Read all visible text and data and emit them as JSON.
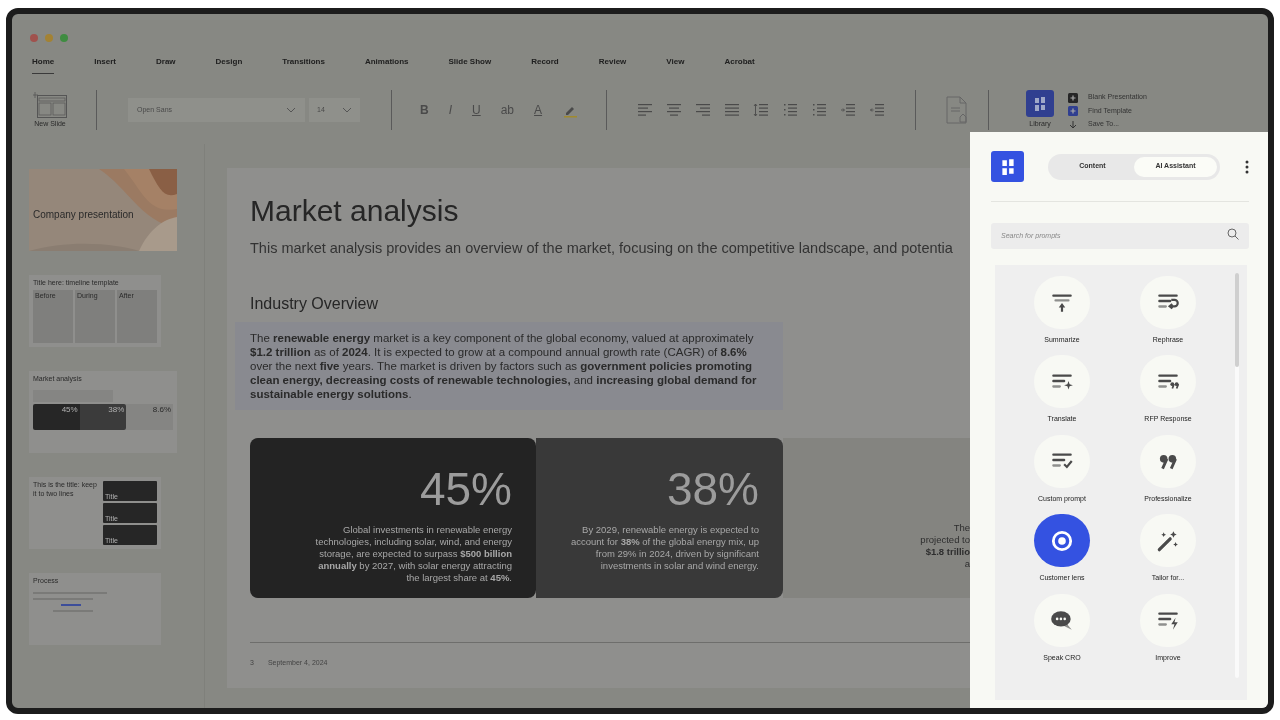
{
  "window": {
    "controls": [
      {
        "color": "#a0524d"
      },
      {
        "color": "#a38233"
      },
      {
        "color": "#3f8c41"
      }
    ]
  },
  "ribbon": {
    "tabs": [
      {
        "label": "Home",
        "selected": true
      },
      {
        "label": "Insert",
        "selected": false
      },
      {
        "label": "Draw",
        "selected": false
      },
      {
        "label": "Design",
        "selected": false
      },
      {
        "label": "Transitions",
        "selected": false
      },
      {
        "label": "Animations",
        "selected": false
      },
      {
        "label": "Slide Show",
        "selected": false
      },
      {
        "label": "Record",
        "selected": false
      },
      {
        "label": "Review",
        "selected": false
      },
      {
        "label": "View",
        "selected": false
      },
      {
        "label": "Acrobat",
        "selected": false
      }
    ],
    "new_slide": "New Slide",
    "font": "Open Sans",
    "size": "14",
    "format_buttons": [
      "B",
      "I",
      "U",
      "ab",
      "A"
    ],
    "library": "Library",
    "actions": [
      {
        "kind": "plus-dark",
        "label": "Blank Presentation"
      },
      {
        "kind": "plus-blue",
        "label": "Find Template"
      },
      {
        "kind": "save",
        "label": "Save To..."
      }
    ]
  },
  "thumbnails": [
    {
      "kind": "cover",
      "title": "Company presentation"
    },
    {
      "kind": "timeline",
      "title": "Title here: timeline template",
      "columns": [
        "Before",
        "During",
        "After"
      ]
    },
    {
      "kind": "stats",
      "title": "Market analysis",
      "stats": [
        "45%",
        "38%",
        "8.6%"
      ]
    },
    {
      "kind": "cards",
      "title": "This is the title: keep it to two lines",
      "cards": [
        "Title",
        "Title",
        "Title"
      ]
    },
    {
      "kind": "process",
      "title": "Process"
    }
  ],
  "slide": {
    "title": "Market analysis",
    "subtitle": "This market analysis provides an overview of the market, focusing on the competitive landscape, and potentia",
    "section": "Industry Overview",
    "paragraph": "The **renewable energy** market is a key component of the global economy, valued at approximately **$1.2 trillion** as of **2024**. It is expected to grow at a compound annual growth rate (CAGR) of **8.6%** over the next **five** years. The market is driven by factors such as **government policies promoting clean energy, decreasing costs of renewable technologies,** and **increasing global demand for sustainable energy solutions**.",
    "stats": [
      {
        "value": "45%",
        "text": "Global investments in renewable energy technologies, including solar, wind, and energy storage, are expected to surpass **$500 billion annually** by 2027, with solar energy attracting the largest share at **45%**."
      },
      {
        "value": "38%",
        "text": "By 2029, renewable energy is expected to account for **38%** of the global energy mix, up from 29% in 2024, driven by significant investments in solar and wind energy."
      }
    ],
    "partial_stat_lines": [
      "The",
      "projected to",
      "**$1.8 trillio**",
      "a"
    ],
    "footer": {
      "page": "3",
      "date": "September 4, 2024"
    }
  },
  "panel": {
    "tabs": [
      {
        "label": "Content",
        "selected": false
      },
      {
        "label": "AI Assistant",
        "selected": true
      }
    ],
    "search": {
      "placeholder": "Search for prompts"
    },
    "prompts": [
      {
        "label": "Summarize",
        "selected": false
      },
      {
        "label": "Rephrase",
        "selected": false
      },
      {
        "label": "Translate",
        "selected": false
      },
      {
        "label": "RFP Response",
        "selected": false
      },
      {
        "label": "Custom prompt",
        "selected": false
      },
      {
        "label": "Professionalize",
        "selected": false
      },
      {
        "label": "Customer lens",
        "selected": true
      },
      {
        "label": "Tailor for...",
        "selected": false
      },
      {
        "label": "Speak CRO",
        "selected": false
      },
      {
        "label": "Improve",
        "selected": false
      }
    ]
  }
}
